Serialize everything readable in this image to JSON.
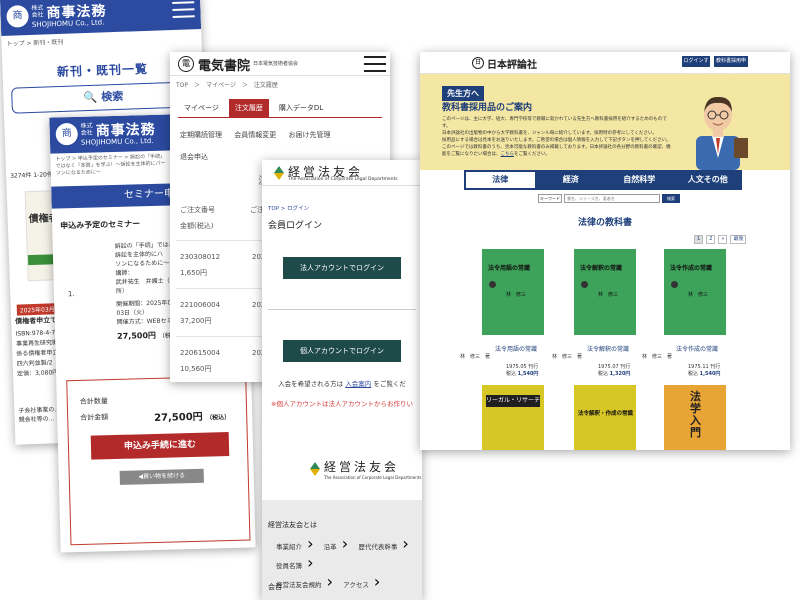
{
  "shojihomu_top": {
    "kaisha": "株式会社",
    "name": "商事法務",
    "roman": "SHOJIHOMU Co., Ltd.",
    "breadcrumb": "トップ > 新刊・既刊",
    "page_title": "新刊・既刊一覧",
    "search_label": "検索",
    "side_count": "3274件 1-20件",
    "book_cover_text": "債権者",
    "date_badge": "2025年03月21日",
    "book_title": "債権者申立て",
    "isbn": "ISBN:978-4-78",
    "line1": "事業再生研究機",
    "line2": "係る債権者申立",
    "line3": "四六判並製/2",
    "price": "定価：3,080円",
    "footer_text": "子会社事業の…",
    "footer_text2": "親会社等の…"
  },
  "shojihomu_seminar": {
    "kaisha": "株式会社",
    "name": "商事法務",
    "roman": "SHOJIHOMU Co., Ltd.",
    "breadcrumb": "トップ > 申込予定のセミナー > 訴訟の「手続」ではなく「本質」を学ぶ！～訴訟を主体的にパーソンになるために～",
    "title": "セミナー申",
    "subtitle": "申込み予定のセミナー",
    "item_num": "1.",
    "desc_1": "訴訟の「手続」ではなく",
    "desc_2": "訴訟を主体的にハ",
    "desc_3": "ソンになるために～",
    "lecturer_label": "講師：",
    "lecturer": "武井祐生　弁護士（",
    "lecturer_2": "所）",
    "date_label": "開催期間：2025年04",
    "date_2": "03日（火）",
    "place": "開催方式：WEBセミ",
    "price": "27,500円",
    "price_tax": "（税込）",
    "qty_label": "合計数量",
    "total_label": "合計金額",
    "total_value": "27,500円",
    "total_tax": "（税込）",
    "apply_button": "申込み手続に進む",
    "continue_button": "◀買い物を続ける"
  },
  "denki": {
    "logo_mark": "電",
    "name": "電気書院",
    "small": "日本電気技術者協会",
    "breadcrumb": "TOP　＞　マイページ　＞　注文履歴",
    "tabs": [
      "マイページ",
      "注文履歴",
      "購入データDL"
    ],
    "links_1": [
      "定期購読管理",
      "会員情報変更",
      "お届け先管理"
    ],
    "links_2": [
      "退会申込"
    ],
    "side_char": "注",
    "col_order": "ご注文番号",
    "col_amount": "金額(税込)",
    "col_date": "ご注文",
    "rows": [
      {
        "order": "230308012",
        "amount": "1,650円",
        "date": "2023/"
      },
      {
        "order": "221006004",
        "amount": "37,200円",
        "date": "2022/"
      },
      {
        "order": "220615004",
        "amount": "10,560円",
        "date": "2022/"
      }
    ]
  },
  "keiei": {
    "name": "経営法友会",
    "english": "The Association of Corporate Legal Departments",
    "breadcrumb": "TOP > ログイン",
    "page_title": "会員ログイン",
    "corp_login": "法人アカウントでログイン",
    "personal_login": "個人アカウントでログイン",
    "join_text_pre": "入会を希望される方は",
    "join_link": "入会案内",
    "join_text_post": "をご覧くだ",
    "warning": "※個人アカウントは法人アカウントからお作りい",
    "footer_name": "経営法友会",
    "footer_english": "The Association of Corporate Legal Departments",
    "footer_heading": "経営法友会とは",
    "footer_items": [
      "事業紹介",
      "沿革",
      "歴代代表幹事",
      "役員名簿",
      "経営法友会規約",
      "アクセス"
    ],
    "footer_more": "会合"
  },
  "nippon_hyoron": {
    "logo_mark": "日",
    "name": "日本評論社",
    "header_btn_login": "ログインする",
    "header_btn_register": "教科書採用申込",
    "badge": "先生方へ",
    "banner_title": "教科書採用品のご案内",
    "banner_text_1": "このページは、主に大学、短大、専門学校等で教職に就かれている先生方へ教科書採用を紹介するためのものです。",
    "banner_text_2": "日本評論社の出版物の中から大学教科書を、ジャンル毎に紹介しています。採用時の参考にしてください。",
    "banner_text_3": "採用品にする場合は見本をお送りいたします。ご希望の場合は個人情報を入力して下記ボタンを押してください。",
    "banner_text_4": "このページでは教科書のうち、見本可能な教科書のみ掲載しております。日本評論社の各分野の教科書の確認、機能をご覧になりたい場合は、",
    "banner_link": "こちら",
    "banner_text_5": "をご覧ください。",
    "tabs": [
      "法律",
      "経済",
      "自然科学",
      "人文その他"
    ],
    "search_select": "キーワード",
    "search_placeholder": "書名、シリーズ名、著者名",
    "search_button": "検索",
    "section_title": "法律の教科書",
    "pager": [
      "1",
      "2",
      "»",
      "最後"
    ],
    "books": [
      {
        "cover": "法令用語の常識",
        "author_cover": "林　修三",
        "name": "法令用語の常識",
        "author": "林　修三　著",
        "date": "1975.05 刊行",
        "price_label": "税込",
        "price": "1,540円"
      },
      {
        "cover": "法令解釈の常識",
        "author_cover": "林　修三",
        "name": "法令解釈の常識",
        "author": "林　修三　著",
        "date": "1975.07 刊行",
        "price_label": "税込",
        "price": "1,320円"
      },
      {
        "cover": "法令作成の常識",
        "author_cover": "林　修三",
        "name": "法令作成の常識",
        "author": "林　修三　著",
        "date": "1975.11 刊行",
        "price_label": "税込",
        "price": "1,540円"
      }
    ],
    "books_row2": [
      {
        "cover": "リーガル・リサーチ"
      },
      {
        "cover": "法令解釈・作成の常識"
      },
      {
        "cover": "法学入門"
      }
    ],
    "colors": {
      "navy": "#1e3f7a",
      "banner": "#f4e6a3",
      "book_green": "#3ea35a",
      "book_yellow": "#d6c626",
      "book_orange": "#e8a535"
    }
  }
}
